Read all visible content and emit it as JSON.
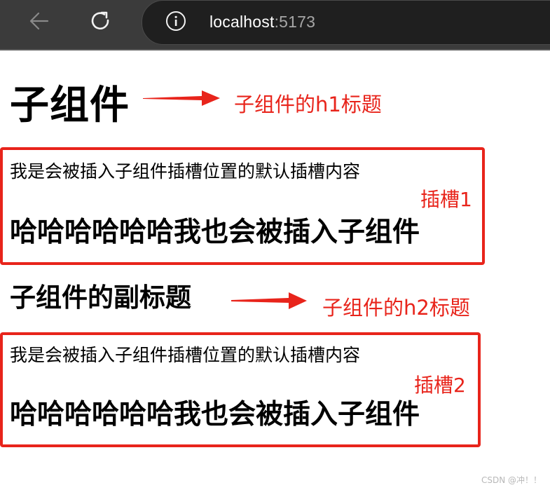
{
  "browser": {
    "address": {
      "host": "localhost",
      "port": ":5173"
    }
  },
  "page": {
    "h1": "子组件",
    "h2": "子组件的副标题",
    "slot1": {
      "default_text": "我是会被插入子组件插槽位置的默认插槽内容",
      "inserted_text": "哈哈哈哈哈哈我也会被插入子组件"
    },
    "slot2": {
      "default_text": "我是会被插入子组件插槽位置的默认插槽内容",
      "inserted_text": "哈哈哈哈哈哈我也会被插入子组件"
    }
  },
  "annotations": {
    "h1_label": "子组件的h1标题",
    "h2_label": "子组件的h2标题",
    "slot1_label": "插槽1",
    "slot2_label": "插槽2",
    "color": "#e8241b"
  },
  "watermark": "CSDN @冲！！",
  "icons": [
    "back-arrow-icon",
    "reload-icon",
    "info-icon"
  ]
}
